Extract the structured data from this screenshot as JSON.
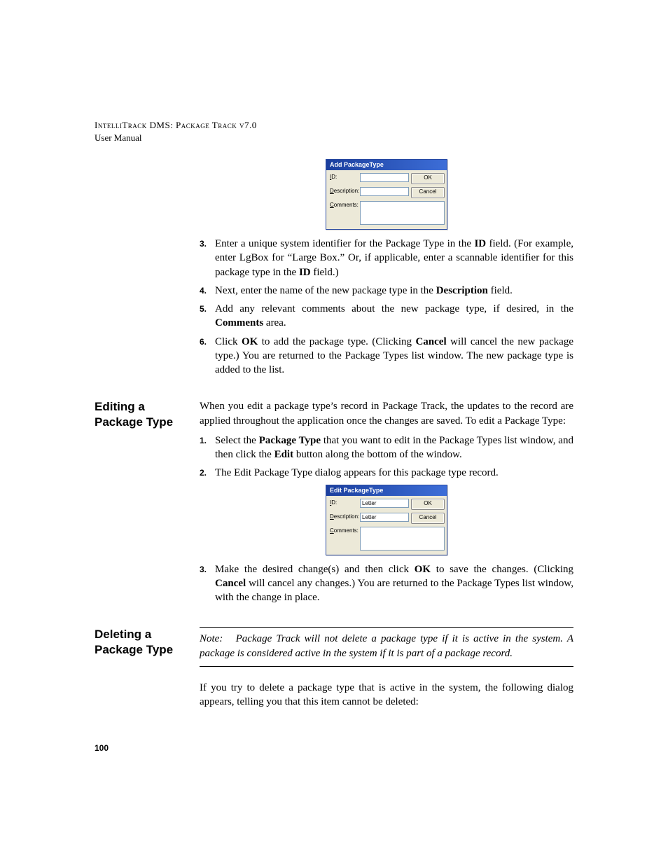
{
  "header": {
    "line1": "IntelliTrack DMS: Package Track v7.0",
    "line2": "User Manual"
  },
  "dialog_add": {
    "title": "Add PackageType",
    "labels": {
      "id": "ID:",
      "desc": "Description:",
      "comments": "Comments:"
    },
    "fields": {
      "id": "",
      "desc": ""
    },
    "buttons": {
      "ok": "OK",
      "cancel": "Cancel"
    }
  },
  "steps_add": [
    {
      "n": "3.",
      "html": "Enter a unique system identifier for the Package Type in the <b>ID</b> field. (For example, enter LgBox for “Large Box.” Or, if applicable, enter a scannable identifier for this package type in the <b>ID</b> field.)"
    },
    {
      "n": "4.",
      "html": "Next, enter the name of the new package type in the <b>Description</b> field."
    },
    {
      "n": "5.",
      "html": "Add any relevant comments about the new package type, if desired, in the <b>Comments</b> area."
    },
    {
      "n": "6.",
      "html": "Click <b>OK</b> to add the package type. (Clicking <b>Cancel</b> will cancel the new package type.) You are returned to the Package Types list window. The new package type is added to the list."
    }
  ],
  "edit_section": {
    "heading": "Editing a Package Type",
    "intro": "When you edit a package type’s record in Package Track, the updates to the record are applied throughout the application once the changes are saved. To edit a Package Type:",
    "steps_before": [
      {
        "n": "1.",
        "html": "Select the <b>Package Type</b> that you want to edit in the Package Types list window, and then click the <b>Edit</b> button along the bottom of the window."
      },
      {
        "n": "2.",
        "html": "The Edit Package Type dialog appears for this package type record."
      }
    ],
    "dialog": {
      "title": "Edit PackageType",
      "labels": {
        "id": "ID:",
        "desc": "Description:",
        "comments": "Comments:"
      },
      "fields": {
        "id": "Letter",
        "desc": "Letter"
      },
      "buttons": {
        "ok": "OK",
        "cancel": "Cancel"
      }
    },
    "steps_after": [
      {
        "n": "3.",
        "html": "Make the desired change(s) and then click <b>OK</b> to save the changes. (Clicking <b>Cancel</b> will cancel any changes.) You are returned to the Package Types list window, with the change in place."
      }
    ]
  },
  "delete_section": {
    "heading": "Deleting a Package Type",
    "note_label": "Note:",
    "note_body": "Package Track will not delete a package type if it is active in the system. A package is considered active in the system if it is part of a package record.",
    "para": "If you try to delete a package type that is active in the system, the following dialog appears, telling you that this item cannot be deleted:"
  },
  "page_number": "100"
}
